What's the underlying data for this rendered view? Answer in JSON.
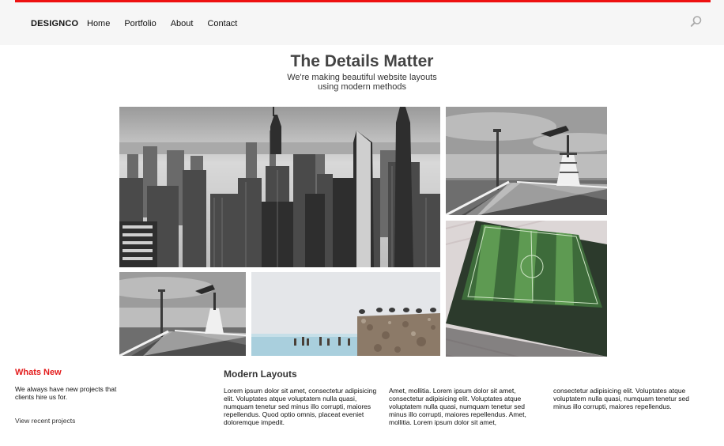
{
  "header": {
    "brand": "DESIGNCO",
    "nav": [
      "Home",
      "Portfolio",
      "About",
      "Contact"
    ],
    "accent_color": "#ee1111",
    "search_icon": "search-icon"
  },
  "hero": {
    "title": "The Details Matter",
    "subtitle": "We're making beautiful website layouts using modern methods"
  },
  "gallery": {
    "photos": [
      "city-skyline-photo",
      "pier-photo-large",
      "soccer-field-photo",
      "pier-photo-small",
      "sea-pillars-photo"
    ]
  },
  "whats_new": {
    "title": "Whats New",
    "text": "We always have new projects that clients hire us for.",
    "link": "View recent projects"
  },
  "modern": {
    "title": "Modern Layouts",
    "columns": [
      "Lorem ipsum dolor sit amet, consectetur adipisicing elit. Voluptates atque voluptatem nulla quasi, numquam tenetur sed minus illo corrupti, maiores repellendus. Quod optio omnis, placeat eveniet doloremque impedit.",
      "Amet, mollitia. Lorem ipsum dolor sit amet, consectetur adipisicing elit. Voluptates atque voluptatem nulla quasi, numquam tenetur sed minus illo corrupti, maiores repellendus. Amet, mollitia. Lorem ipsum dolor sit amet,",
      "consectetur adipisicing elit. Voluptates atque voluptatem nulla quasi, numquam tenetur sed minus illo corrupti, maiores repellendus."
    ]
  }
}
